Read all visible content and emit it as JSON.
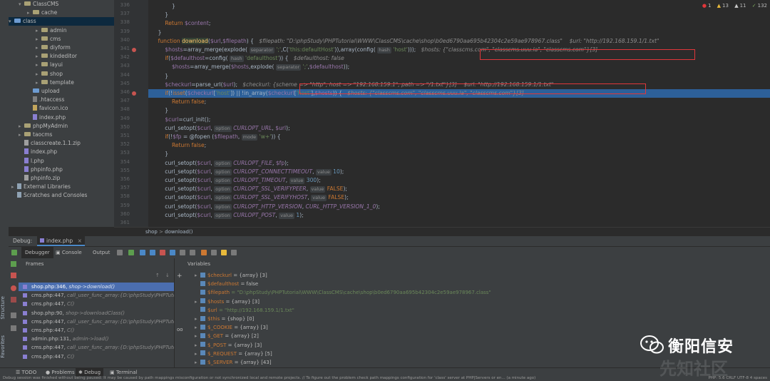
{
  "tree": [
    {
      "label": "ClassCMS",
      "indent": 0,
      "type": "folder",
      "arrow": "v"
    },
    {
      "label": "cache",
      "indent": 1,
      "type": "folder",
      "arrow": ">"
    },
    {
      "label": "class",
      "indent": 1,
      "type": "folder",
      "arrow": "v",
      "selected": true
    },
    {
      "label": "admin",
      "indent": 2,
      "type": "folder",
      "arrow": ">"
    },
    {
      "label": "cms",
      "indent": 2,
      "type": "folder",
      "arrow": ">"
    },
    {
      "label": "diyform",
      "indent": 2,
      "type": "folder",
      "arrow": ">"
    },
    {
      "label": "kindeditor",
      "indent": 2,
      "type": "folder",
      "arrow": ">"
    },
    {
      "label": "layui",
      "indent": 2,
      "type": "folder",
      "arrow": ">"
    },
    {
      "label": "shop",
      "indent": 2,
      "type": "folder",
      "arrow": ">"
    },
    {
      "label": "template",
      "indent": 2,
      "type": "folder",
      "arrow": ">"
    },
    {
      "label": "upload",
      "indent": 1,
      "type": "folder",
      "arrow": ""
    },
    {
      "label": ".htaccess",
      "indent": 1,
      "type": "ht",
      "arrow": ""
    },
    {
      "label": "favicon.ico",
      "indent": 1,
      "type": "ico",
      "arrow": ""
    },
    {
      "label": "index.php",
      "indent": 1,
      "type": "php",
      "arrow": ""
    },
    {
      "label": "phpMyAdmin",
      "indent": 0,
      "type": "folder",
      "arrow": ">"
    },
    {
      "label": "taocms",
      "indent": 0,
      "type": "folder",
      "arrow": ">"
    },
    {
      "label": "classcreate.1.1.zip",
      "indent": 0,
      "type": "zip",
      "arrow": ""
    },
    {
      "label": "index.php",
      "indent": 0,
      "type": "php",
      "arrow": ""
    },
    {
      "label": "l.php",
      "indent": 0,
      "type": "php",
      "arrow": ""
    },
    {
      "label": "phpinfo.php",
      "indent": 0,
      "type": "php",
      "arrow": ""
    },
    {
      "label": "phpinfo.zip",
      "indent": 0,
      "type": "zip",
      "arrow": ""
    },
    {
      "label": "External Libraries",
      "indent": -1,
      "type": "lib",
      "arrow": ">"
    },
    {
      "label": "Scratches and Consoles",
      "indent": -1,
      "type": "lib",
      "arrow": ""
    }
  ],
  "indicators": {
    "errors": "1",
    "warnings": "13",
    "weak": "11",
    "typos": "132"
  },
  "lines": [
    "336",
    "337",
    "338",
    "339",
    "340",
    "341",
    "342",
    "343",
    "344",
    "345",
    "346",
    "347",
    "348",
    "349",
    "350",
    "351",
    "352",
    "353",
    "354",
    "355",
    "356",
    "357",
    "358",
    "359",
    "360",
    "361"
  ],
  "code": [
    {
      "t": "            }"
    },
    {
      "t": "        }"
    },
    {
      "t": "        Return $content;"
    },
    {
      "t": "    }"
    },
    {
      "t": "    function download($url,$filepath) {"
    },
    {
      "t": "        $hosts=array_merge(explode("
    },
    {
      "t": "        if($defaulthost=config("
    },
    {
      "t": "            $hosts=array_merge($hosts,explode("
    },
    {
      "t": "        }"
    },
    {
      "t": "        $checkurl=parse_url($url);"
    },
    {
      "t": "        if(!isset($checkurl['host']) || !in_array($checkurl['host'],$hosts)) {"
    },
    {
      "t": "            Return false;"
    },
    {
      "t": "        }"
    },
    {
      "t": "        $curl=curl_init();"
    },
    {
      "t": "        curl_setopt($curl,"
    },
    {
      "t": "        if(!$fp = @fopen ($filepath,"
    },
    {
      "t": "            Return false;"
    },
    {
      "t": "        }"
    },
    {
      "t": "        curl_setopt($curl,"
    },
    {
      "t": "        curl_setopt($curl,"
    },
    {
      "t": "        curl_setopt($curl,"
    },
    {
      "t": "        curl_setopt($curl,"
    },
    {
      "t": "        curl_setopt($curl,"
    },
    {
      "t": "        curl_setopt($curl,"
    },
    {
      "t": "        curl_setopt($curl,"
    }
  ],
  "inline": {
    "fp_hint": "$filepath: \"D:\\phpStudy\\PHPTutorial\\WWW\\ClassCMS\\cache\\shop\\b0ed6790aa695b42304c2e59ae978967.class\"",
    "url_hint": "$url: \"http://192.168.159.1/1.txt\"",
    "hosts_hint": "$hosts: {\"classcms.com\", \"classcms.uuu.la\", \"classcms.com\"}[3]",
    "defaulthost_hint": "$defaulthost: false",
    "checkurl_hint": "$checkurl: {scheme => \"http\", host => \"192.168.159.1\", path => \"/1.txt\"}[3]",
    "url_hint2": "$url: \"http://192.168.159.1/1.txt\"",
    "hosts_hint2": "$hosts: {\"classcms.com\", \"classcms.uuu.la\", \"classcms.com\"}[3]",
    "sep": "separator",
    "hash": "hash",
    "option": "option",
    "value": "value",
    "mode": "mode",
    "semi": "';'",
    "this_default": "'this:defaultHost'",
    "host_str": "'host'",
    "defaulthost_str": "'defaulthost'",
    "c_call": "C(",
    "config_call": "array(config(",
    "w_mode": "'w+'",
    "opts": [
      {
        "name": "CURLOPT_URL",
        "val": "$url",
        "isValue": false
      },
      {
        "name": "CURLOPT_FILE",
        "val": "$fp",
        "isValue": false
      },
      {
        "name": "CURLOPT_CONNECTTIMEOUT",
        "val": "10",
        "isValue": true
      },
      {
        "name": "CURLOPT_TIMEOUT",
        "val": "300",
        "isValue": true
      },
      {
        "name": "CURLOPT_SSL_VERIFYPEER",
        "val": "FALSE",
        "isValue": true
      },
      {
        "name": "CURLOPT_SSL_VERIFYHOST",
        "val": "FALSE",
        "isValue": true
      },
      {
        "name": "CURLOPT_HTTP_VERSION",
        "val": "CURL_HTTP_VERSION_1_0",
        "isValue": false
      },
      {
        "name": "CURLOPT_POST",
        "val": "1",
        "isValue": true
      }
    ]
  },
  "breadcrumb": {
    "cls": "shop",
    "fn": "download()"
  },
  "debug": {
    "label": "Debug:",
    "file": "index.php",
    "tab_debugger": "Debugger",
    "tab_console": "Console",
    "tab_output": "Output",
    "frames_title": "Frames",
    "vars_title": "Variables"
  },
  "frames": [
    {
      "file": "shop.php:346,",
      "fn": "shop->download()",
      "sel": true
    },
    {
      "file": "cms.php:447,",
      "fn": "call_user_func_array:{D:\\phpStudy\\PHPTutoria",
      "sel": false
    },
    {
      "file": "cms.php:447,",
      "fn": "C()",
      "sel": false
    },
    {
      "file": "shop.php:90,",
      "fn": "shop->downloadClass()",
      "sel": false
    },
    {
      "file": "cms.php:447,",
      "fn": "call_user_func_array:{D:\\phpStudy\\PHPTutoria",
      "sel": false
    },
    {
      "file": "cms.php:447,",
      "fn": "C()",
      "sel": false
    },
    {
      "file": "admin.php:131,",
      "fn": "admin->load()",
      "sel": false
    },
    {
      "file": "cms.php:447,",
      "fn": "call_user_func_array:{D:\\phpStudy\\PHPTutoria",
      "sel": false
    },
    {
      "file": "cms.php:447,",
      "fn": "C()",
      "sel": false
    }
  ],
  "variables": [
    {
      "name": "$checkurl",
      "val": "= {array} [3]",
      "str": false,
      "arrow": true
    },
    {
      "name": "$defaulthost",
      "val": "= false",
      "str": false,
      "arrow": false
    },
    {
      "name": "$filepath",
      "val": "= \"D:\\phpStudy\\PHPTutorial\\WWW\\ClassCMS\\cache\\shop\\b0ed6790aa695b42304c2e59ae978967.class\"",
      "str": true,
      "arrow": false
    },
    {
      "name": "$hosts",
      "val": "= {array} [3]",
      "str": false,
      "arrow": true
    },
    {
      "name": "$url",
      "val": "= \"http://192.168.159.1/1.txt\"",
      "str": true,
      "arrow": false
    },
    {
      "name": "$this",
      "val": "= {shop} [0]",
      "str": false,
      "arrow": true
    },
    {
      "name": "$_COOKIE",
      "val": "= {array} [3]",
      "str": false,
      "arrow": true
    },
    {
      "name": "$_GET",
      "val": "= {array} [2]",
      "str": false,
      "arrow": true
    },
    {
      "name": "$_POST",
      "val": "= {array} [3]",
      "str": false,
      "arrow": true
    },
    {
      "name": "$_REQUEST",
      "val": "= {array} [5]",
      "str": false,
      "arrow": true
    },
    {
      "name": "$_SERVER",
      "val": "= {array} [43]",
      "str": false,
      "arrow": true
    }
  ],
  "bottom_tabs": [
    "TODO",
    "Problems",
    "Debug",
    "Terminal"
  ],
  "status_text": "Debug session was finished without being paused: It may be caused by path mappings misconfiguration or not synchronized local and remote projects. // To figure out the problem check path mappings configuration for 'class' server at PHP|Servers or en... (a minute ago)",
  "status_right": "PHP: 5.6   CRLF   UTF-8   4 spaces",
  "watermark": {
    "brand": "衡阳信安",
    "faint": "先知社区"
  },
  "left_labels": [
    "Structure",
    "Favorites"
  ]
}
